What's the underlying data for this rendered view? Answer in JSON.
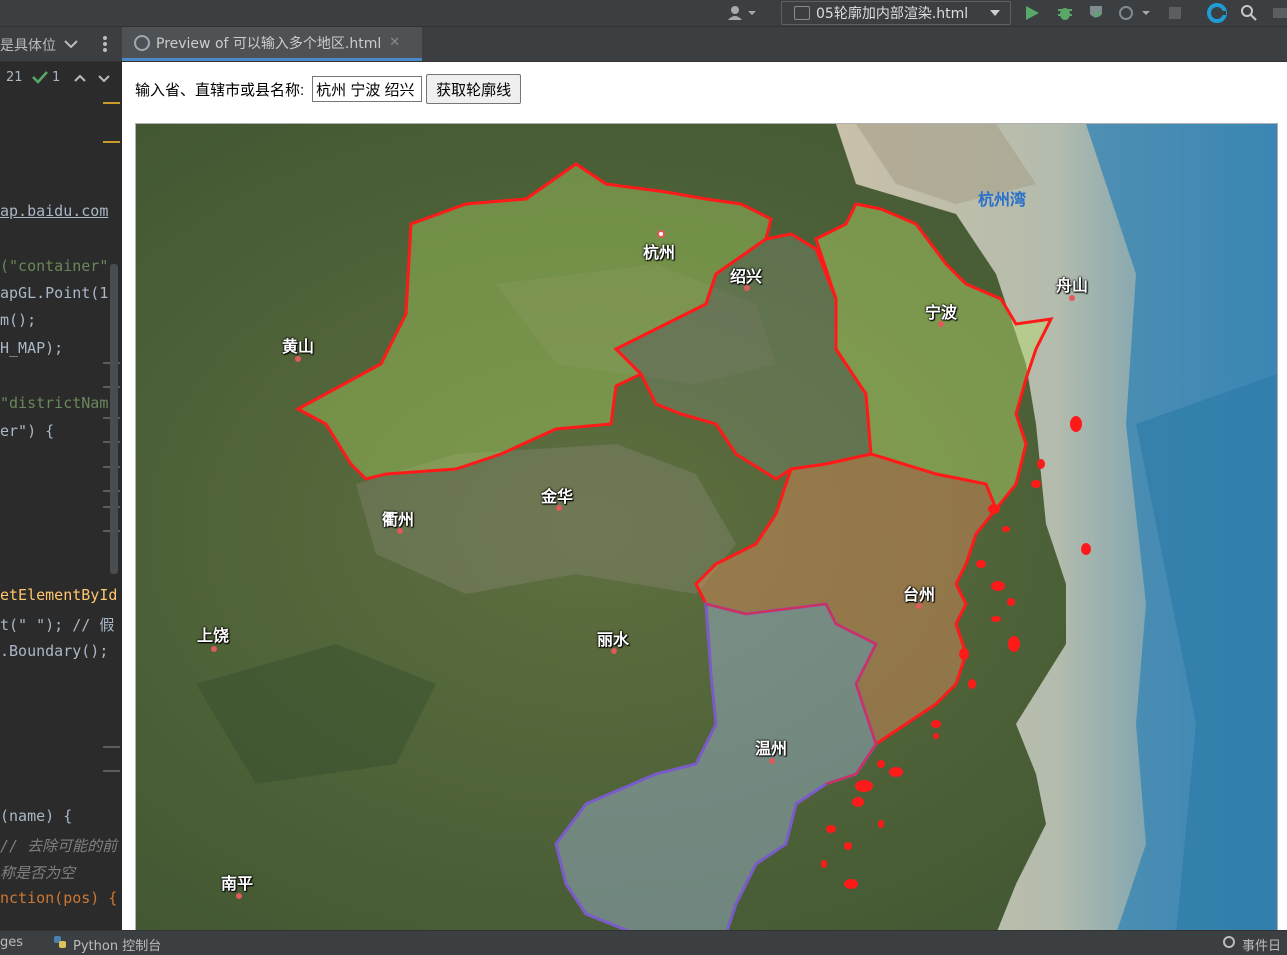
{
  "toolbar": {
    "run_config": "05轮廓加内部渲染.html"
  },
  "left_panel": {
    "header_title": "是具体位",
    "error_count": "21",
    "check_count": "1"
  },
  "code_lines": [
    {
      "text": "ap.baidu.com",
      "color": "#a9b7c6"
    },
    {
      "text": "(\"container\"",
      "color": "#6a8759"
    },
    {
      "text": "apGL.Point(1",
      "color": "#a9b7c6"
    },
    {
      "text": "m();",
      "color": "#a9b7c6"
    },
    {
      "text": "H_MAP);",
      "color": "#a9b7c6"
    },
    {
      "text": "\"districtNam",
      "color": "#6a8759"
    },
    {
      "text": "er\") {",
      "color": "#a9b7c6"
    },
    {
      "text": "etElementById",
      "color": "#ffc66d"
    },
    {
      "text": "t(\" \"); // 假",
      "color": "#a9b7c6"
    },
    {
      "text": ".Boundary();",
      "color": "#a9b7c6"
    },
    {
      "text": "(name) {",
      "color": "#a9b7c6"
    },
    {
      "text": "// 去除可能的前",
      "color": "#808080"
    },
    {
      "text": "称是否为空",
      "color": "#808080"
    },
    {
      "text": "nction(pos) {",
      "color": "#cc7832"
    }
  ],
  "tab": {
    "title": "Preview of 可以输入多个地区.html"
  },
  "form": {
    "label": "输入省、直辖市或县名称:",
    "input_value": "杭州 宁波 绍兴",
    "button": "获取轮廓线"
  },
  "map": {
    "water_label": "杭州湾",
    "cities": [
      "杭州",
      "绍兴",
      "宁波",
      "舟山",
      "黄山",
      "金华",
      "衢州",
      "台州",
      "丽水",
      "上饶",
      "温州",
      "南平"
    ],
    "colors": {
      "boundary_red": "#ff1a1a",
      "boundary_purple": "#7a5cc8",
      "fill_green": "#a8d060",
      "fill_orange": "#d48a5a",
      "fill_blue": "#9fb8d8",
      "sea": "#4a90b8"
    }
  },
  "statusbar": {
    "left_text": "ges",
    "python_console": "Python 控制台",
    "event_log": "事件日"
  }
}
